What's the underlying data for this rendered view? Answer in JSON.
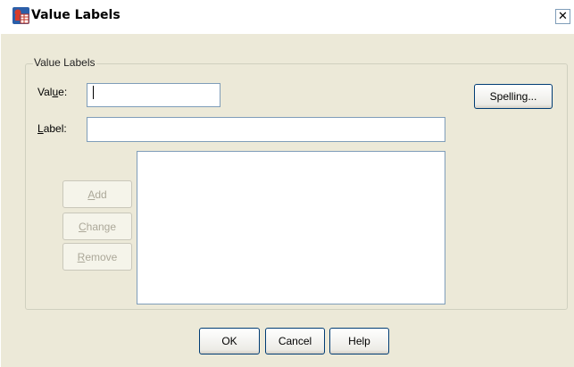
{
  "window": {
    "title": "Value Labels",
    "close_glyph": "✕"
  },
  "icons": {
    "title_icon": "spss-value-labels-icon",
    "close_icon": "close-icon"
  },
  "group": {
    "legend": "Value Labels"
  },
  "fields": {
    "value": {
      "label_pre": "Val",
      "label_ul": "u",
      "label_post": "e:",
      "value": ""
    },
    "label": {
      "label_pre": "",
      "label_ul": "L",
      "label_post": "abel:",
      "value": ""
    }
  },
  "buttons": {
    "spelling": "Spelling...",
    "add": {
      "ul": "A",
      "rest": "dd"
    },
    "change": {
      "ul": "C",
      "rest": "hange"
    },
    "remove": {
      "ul": "R",
      "rest": "emove"
    },
    "ok": "OK",
    "cancel": "Cancel",
    "help": "Help"
  },
  "list": {
    "items": []
  },
  "colors": {
    "dialog_bg": "#ECE9D8",
    "input_border": "#7f9db9",
    "button_border": "#003c74",
    "disabled_text": "#aca899"
  }
}
